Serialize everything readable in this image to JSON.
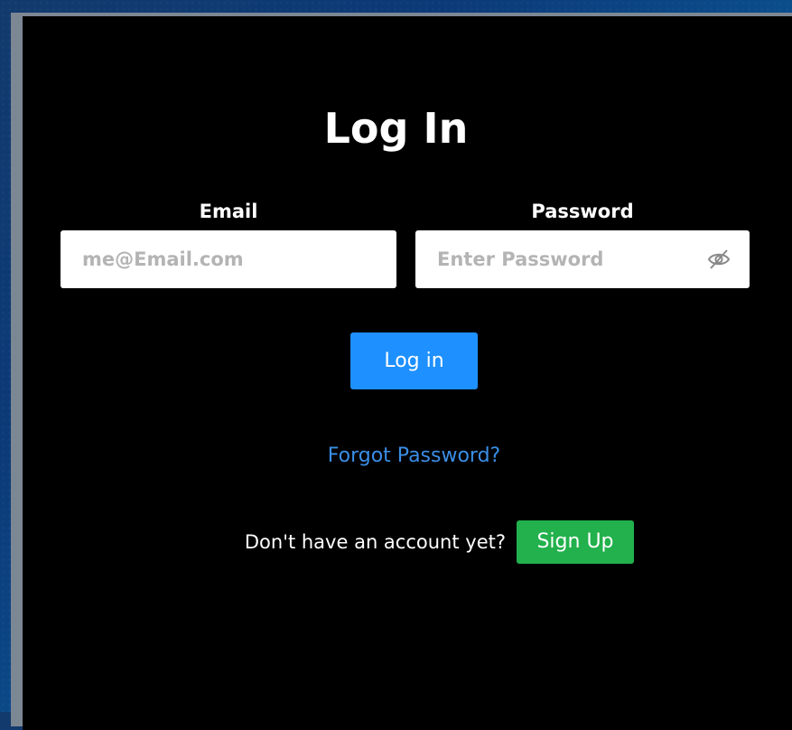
{
  "form": {
    "title": "Log In",
    "email": {
      "label": "Email",
      "placeholder": "me@Email.com",
      "value": ""
    },
    "password": {
      "label": "Password",
      "placeholder": "Enter Password",
      "value": "",
      "toggle_icon": "eye-slash-icon"
    },
    "login_button_label": "Log in",
    "forgot_password_link": "Forgot Password?",
    "signup_prompt": "Don't have an account yet?",
    "signup_button_label": "Sign Up"
  },
  "colors": {
    "card_background": "#000000",
    "login_button": "#1e90ff",
    "signup_button": "#22b14c",
    "link": "#3b8ee6",
    "placeholder": "#b4b4b4"
  }
}
